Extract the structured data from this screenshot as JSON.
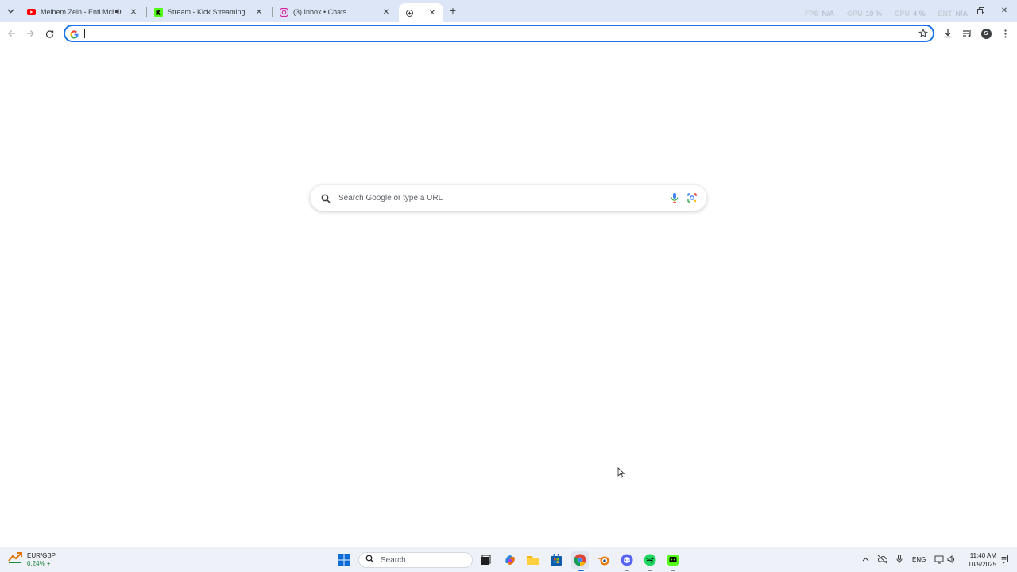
{
  "tabs": [
    {
      "title": "Melhem Zein - Enti Mchiti |",
      "favicon": "youtube-icon",
      "audio": true
    },
    {
      "title": "Stream - Kick Streaming",
      "favicon": "kick-icon"
    },
    {
      "title": "(3) Inbox • Chats",
      "favicon": "instagram-icon"
    },
    {
      "title": "",
      "favicon": "new-tab-icon",
      "active": true
    }
  ],
  "overlay": {
    "fps_label": "FPS",
    "fps_value": "N/A",
    "gpu_label": "GPU",
    "gpu_value": "10 %",
    "cpu_label": "CPU",
    "cpu_value": "4 %",
    "ent_label": "ENT",
    "ent_value": "N/A"
  },
  "omnibox": {
    "value": "",
    "placeholder": ""
  },
  "profile": {
    "initial": "S"
  },
  "ntp": {
    "search_placeholder": "Search Google or type a URL"
  },
  "taskbar": {
    "widget_pair": "EUR/GBP",
    "widget_change": "0.24% +",
    "search_label": "Search",
    "language": "ENG",
    "time": "11:40 AM",
    "date": "10/9/2025"
  },
  "colors": {
    "accent": "#1a73e8",
    "tabstrip": "#dde6f7",
    "taskbar": "#eef1f7"
  }
}
